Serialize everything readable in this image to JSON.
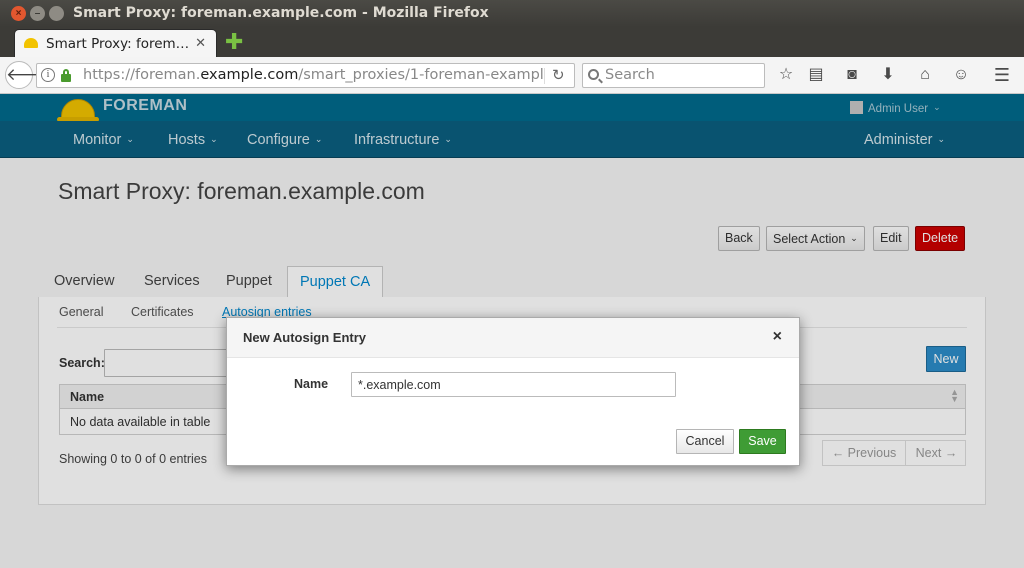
{
  "window": {
    "title": "Smart Proxy: foreman.example.com - Mozilla Firefox"
  },
  "browser": {
    "tab_label": "Smart Proxy: forem…",
    "url_prefix": "https://foreman.",
    "url_host": "example.com",
    "url_path": "/smart_proxies/1-foreman-example-",
    "search_placeholder": "Search"
  },
  "app": {
    "brand": "FOREMAN",
    "user": "Admin User",
    "nav": [
      {
        "label": "Monitor"
      },
      {
        "label": "Hosts"
      },
      {
        "label": "Configure"
      },
      {
        "label": "Infrastructure"
      },
      {
        "label": "Administer"
      }
    ]
  },
  "page": {
    "title": "Smart Proxy: foreman.example.com",
    "actions": {
      "back": "Back",
      "select_action": "Select Action",
      "edit": "Edit",
      "delete": "Delete"
    },
    "tabs": [
      {
        "label": "Overview"
      },
      {
        "label": "Services"
      },
      {
        "label": "Puppet"
      },
      {
        "label": "Puppet CA",
        "active": true
      }
    ],
    "subtabs": [
      {
        "label": "General"
      },
      {
        "label": "Certificates"
      },
      {
        "label": "Autosign entries",
        "active": true
      }
    ],
    "search_label": "Search:",
    "new_button": "New",
    "table": {
      "columns": [
        "Name"
      ],
      "empty_text": "No data available in table"
    },
    "showing": "Showing 0 to 0 of 0 entries",
    "pager": {
      "previous": "← Previous",
      "next": "Next →"
    }
  },
  "modal": {
    "title": "New Autosign Entry",
    "close": "×",
    "name_label": "Name",
    "name_value": "*.example.com",
    "cancel": "Cancel",
    "save": "Save"
  },
  "colors": {
    "header_top": "#006a8c",
    "nav_bar": "#0b5f80",
    "link_active": "#0088ce",
    "danger": "#cc0000",
    "primary": "#2c8dc9",
    "success": "#3f9c35"
  }
}
